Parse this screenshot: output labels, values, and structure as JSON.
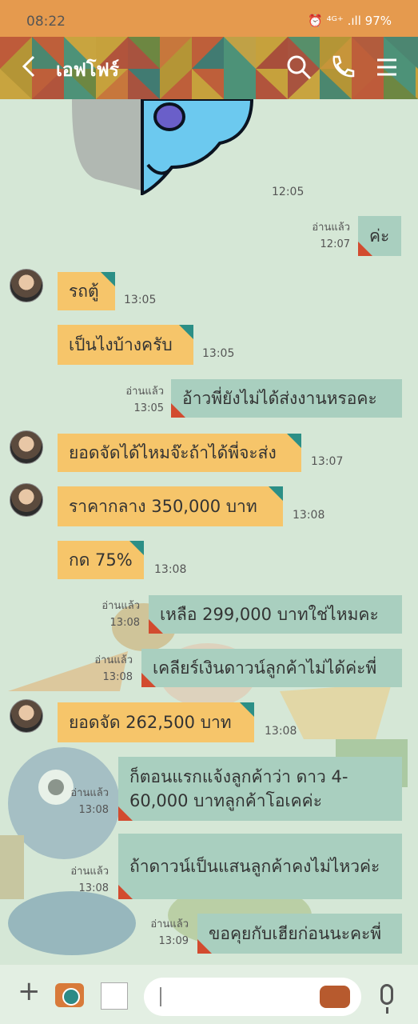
{
  "status": {
    "time": "08:22",
    "indicators": "⏰ ⁴ᴳ⁺ .ıll 97%"
  },
  "header": {
    "title": "เอฟโฟร์",
    "back_icon": "back-arrow-icon",
    "search_icon": "search-icon",
    "call_icon": "phone-icon",
    "menu_icon": "menu-icon"
  },
  "messages": [
    {
      "time": "12:05"
    },
    {
      "read": "อ่านแล้ว",
      "time": "12:07",
      "text": "ค่ะ"
    },
    {
      "text": "รถตู้",
      "time": "13:05"
    },
    {
      "text": "เป็นไงบ้างครับ",
      "time": "13:05"
    },
    {
      "read": "อ่านแล้ว",
      "time": "13:05",
      "text": "อ้าวพี่ยังไม่ได้ส่งงานหรอคะ"
    },
    {
      "text": "ยอดจัดได้ไหมจ๊ะถ้าได้พี่จะส่ง",
      "time": "13:07"
    },
    {
      "text": "ราคากลาง 350,000 บาท",
      "time": "13:08"
    },
    {
      "text": "กด 75%",
      "time": "13:08"
    },
    {
      "read": "อ่านแล้ว",
      "time": "13:08",
      "text": "เหลือ 299,000 บาทใช่ไหมคะ"
    },
    {
      "read": "อ่านแล้ว",
      "time": "13:08",
      "text": "เคลียร์เงินดาวน์ลูกค้าไม่ได้ค่ะพี่"
    },
    {
      "text": "ยอดจัด 262,500 บาท",
      "time": "13:08"
    },
    {
      "read": "อ่านแล้ว",
      "time": "13:08",
      "text": "ก็ตอนแรกแจ้งลูกค้าว่า ดาว 4-60,000 บาทลูกค้าโอเคค่ะ"
    },
    {
      "read": "อ่านแล้ว",
      "time": "13:08",
      "text": "ถ้าดาวน์เป็นแสนลูกค้าคงไม่ไหวค่ะ"
    },
    {
      "read": "อ่านแล้ว",
      "time": "13:09",
      "text": "ขอคุยกับเฮียก่อนนะคะพี่"
    }
  ],
  "bottom": {
    "plus_icon": "plus-icon",
    "camera_icon": "camera-icon",
    "gallery_icon": "gallery-icon",
    "sticker_icon": "sticker-icon",
    "mic_icon": "mic-icon"
  }
}
